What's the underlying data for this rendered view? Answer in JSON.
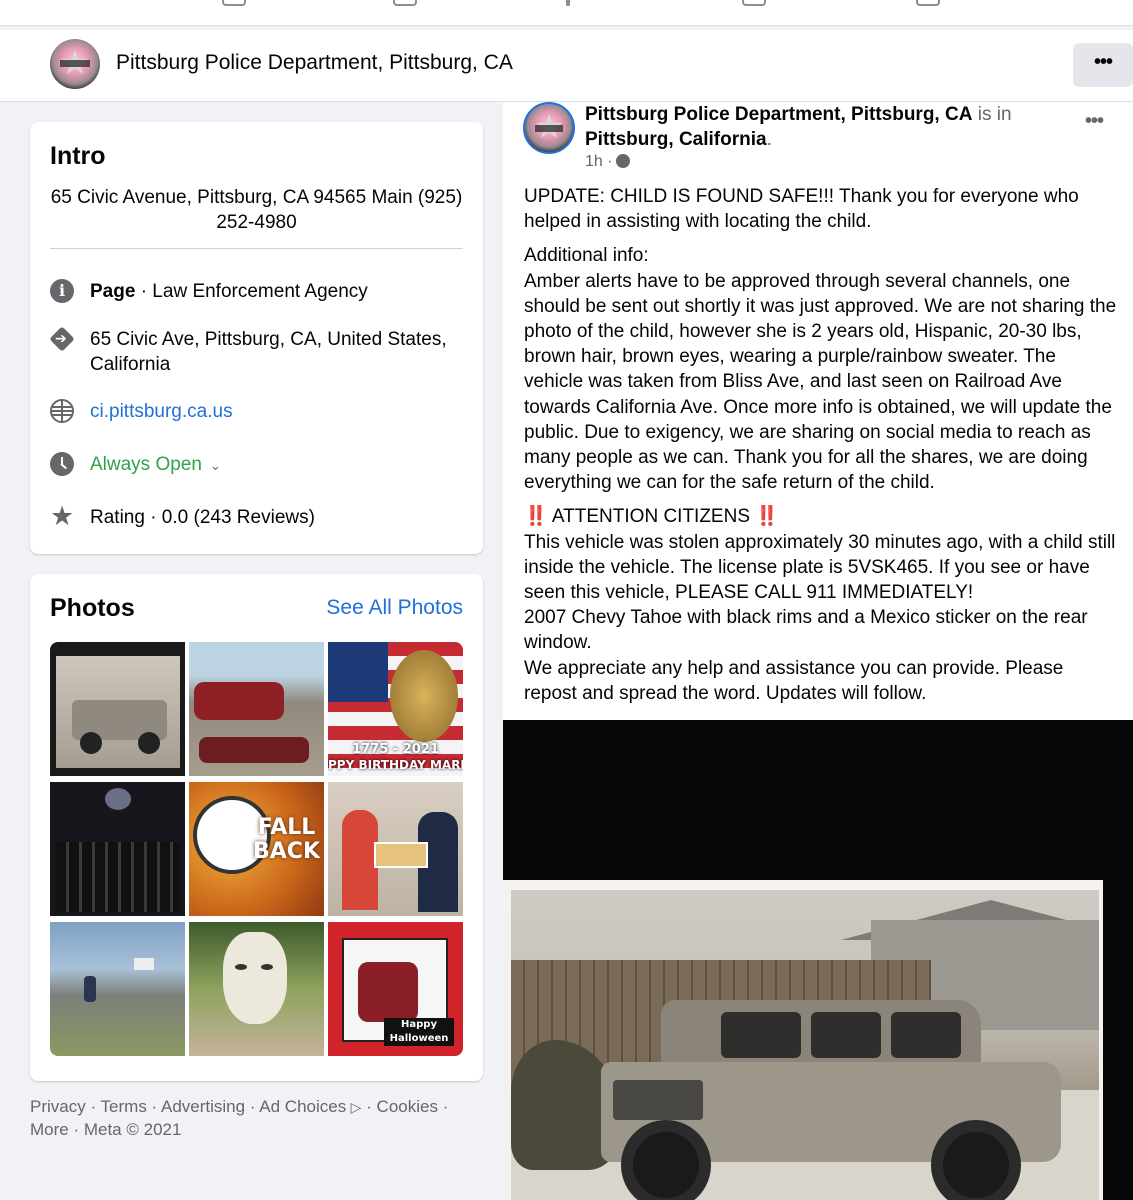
{
  "page": {
    "title": "Pittsburg Police Department, Pittsburg, CA",
    "more_label": "•••"
  },
  "intro": {
    "heading": "Intro",
    "bio": "65 Civic Avenue, Pittsburg, CA 94565 Main (925) 252-4980",
    "category_label": "Page",
    "category_value": " · Law Enforcement Agency",
    "address": "65 Civic Ave, Pittsburg, CA, United States, California",
    "website": "ci.pittsburg.ca.us",
    "hours": "Always Open",
    "rating": "Rating · 0.0 (243 Reviews)",
    "icons": [
      "info-icon",
      "directions-icon",
      "globe-icon",
      "clock-icon",
      "star-icon"
    ]
  },
  "photos": {
    "heading": "Photos",
    "see_all": "See All Photos",
    "captions": {
      "marines_year": "1775 - 2021",
      "marines_text": "PPY BIRTHDAY MARIN",
      "fall_back": "FALL BACK",
      "halloween": "Happy Halloween"
    }
  },
  "footer": {
    "links": [
      "Privacy",
      "Terms",
      "Advertising",
      "Ad Choices",
      "Cookies",
      "More"
    ],
    "copyright": "Meta © 2021"
  },
  "post": {
    "author": "Pittsburg Police Department, Pittsburg, CA",
    "is_in": "is in",
    "location": "Pittsburg, California",
    "time": "1h ·",
    "dots": "•••",
    "update": "UPDATE: CHILD IS FOUND SAFE!!! Thank you for everyone who helped in assisting with locating the child.",
    "additional": "Additional info:\nAmber alerts have to be approved through several channels, one should be sent out shortly it was just approved. We are not sharing the photo of the child, however she is 2 years old, Hispanic, 20-30 lbs, brown hair, brown eyes, wearing a purple/rainbow sweater. The vehicle was taken from Bliss Ave, and last seen on Railroad Ave towards California Ave. Once more info is obtained, we will update the public. Due to exigency, we are sharing on social media to reach as many people as we can. Thank you for all the shares, we are doing everything we can for the safe return of the child.",
    "attention_mark": "‼️",
    "attention": "ATTENTION CITIZENS",
    "alert": "This vehicle was stolen approximately 30 minutes ago, with a child still inside the vehicle. The license plate is 5VSK465. If you see or have seen this vehicle, PLEASE CALL 911 IMMEDIATELY!\n2007 Chevy Tahoe with black rims and a Mexico sticker on the rear window.\nWe appreciate any help and assistance you can provide. Please repost and spread the word. Updates will follow."
  },
  "colors": {
    "link": "#216fdb",
    "open_green": "#31a24c",
    "text_secondary": "#65676b",
    "background": "#f0f2f5"
  }
}
